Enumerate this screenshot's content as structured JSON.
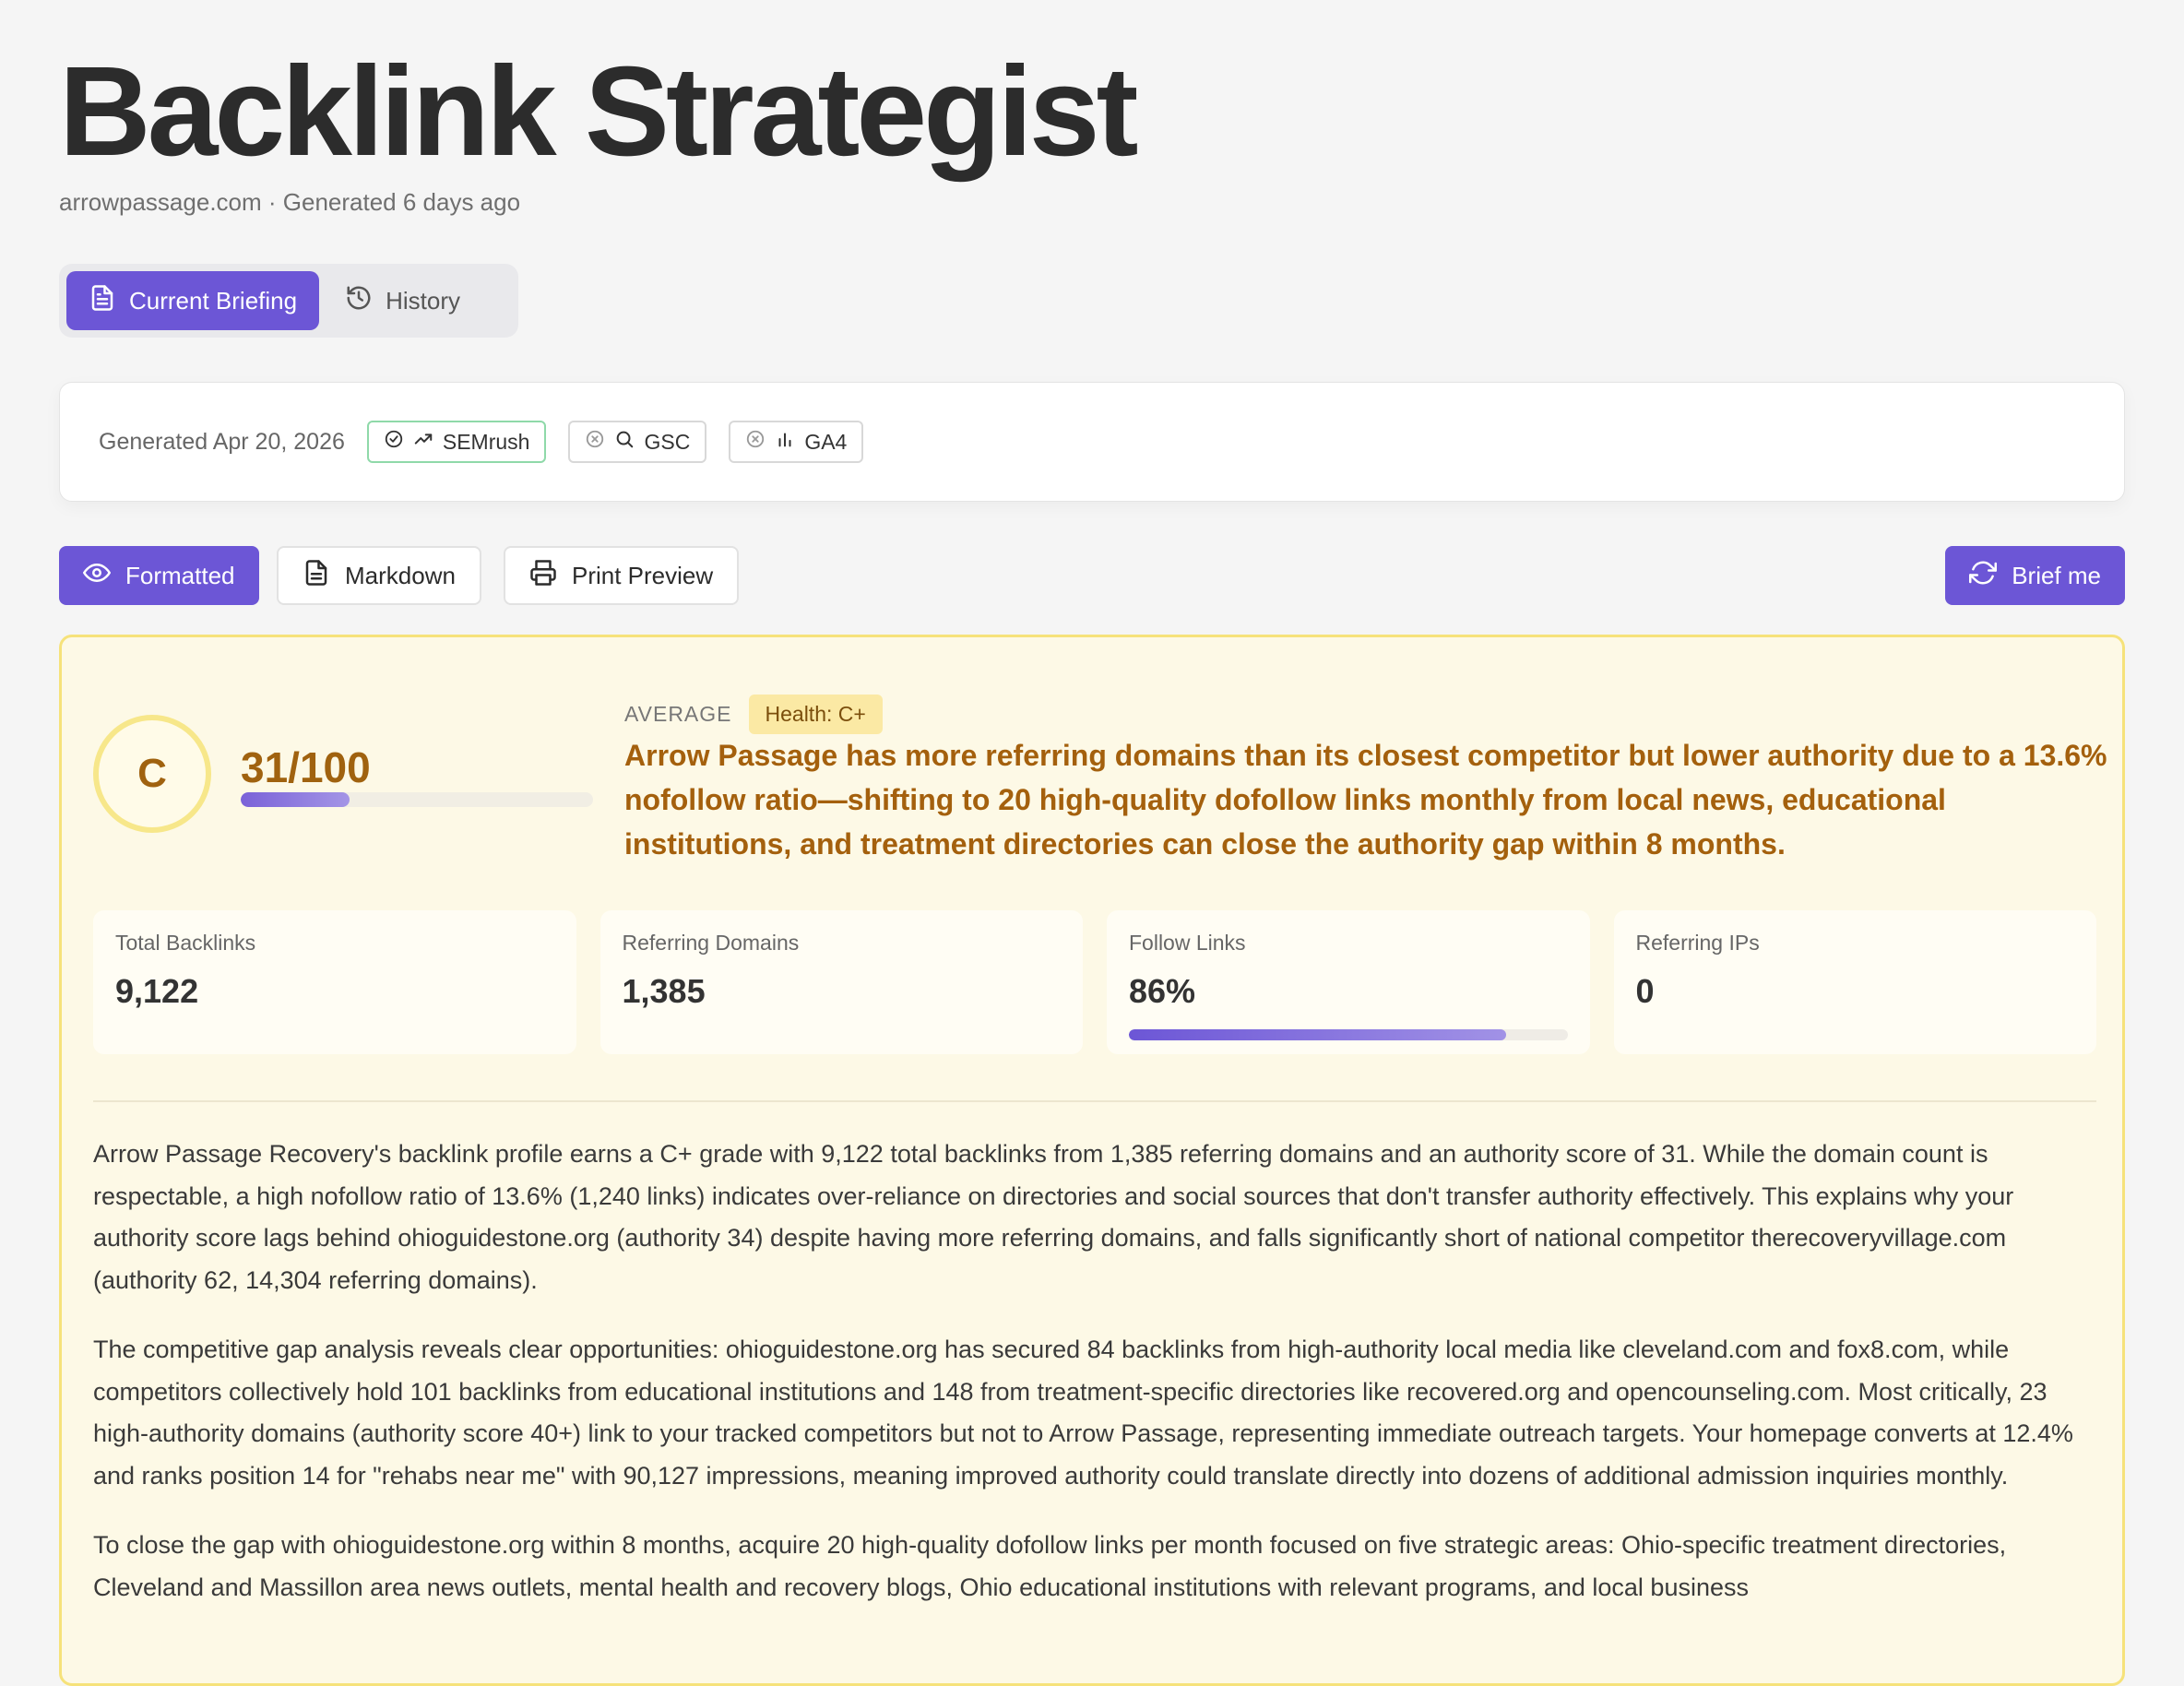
{
  "header": {
    "title": "Backlink Strategist",
    "subtitle": "arrowpassage.com · Generated 6 days ago"
  },
  "tabs": [
    {
      "label": "Current Briefing",
      "icon": "document-icon",
      "active": true
    },
    {
      "label": "History",
      "icon": "history-icon",
      "active": false
    }
  ],
  "meta": {
    "generated": "Generated Apr 20, 2026",
    "sources": [
      {
        "label": "SEMrush",
        "status": "connected",
        "icon": "trending-up-icon"
      },
      {
        "label": "GSC",
        "status": "disconnected",
        "icon": "search-icon"
      },
      {
        "label": "GA4",
        "status": "disconnected",
        "icon": "bar-chart-icon"
      }
    ]
  },
  "toolbar": {
    "formatted": "Formatted",
    "markdown": "Markdown",
    "print_preview": "Print Preview",
    "brief_me": "Brief me"
  },
  "report": {
    "grade": "C",
    "score": "31/100",
    "score_fraction": 0.31,
    "level": "AVERAGE",
    "health": "Health: C+",
    "headline": "Arrow Passage has more referring domains than its closest competitor but lower authority due to a 13.6% nofollow ratio—shifting to 20 high-quality dofollow links monthly from local news, educational institutions, and treatment directories can close the authority gap within 8 months.",
    "stats": [
      {
        "label": "Total Backlinks",
        "value": "9,122"
      },
      {
        "label": "Referring Domains",
        "value": "1,385"
      },
      {
        "label": "Follow Links",
        "value": "86%",
        "fraction": 0.86
      },
      {
        "label": "Referring IPs",
        "value": "0"
      }
    ],
    "paragraphs": [
      "Arrow Passage Recovery's backlink profile earns a C+ grade with 9,122 total backlinks from 1,385 referring domains and an authority score of 31. While the domain count is respectable, a high nofollow ratio of 13.6% (1,240 links) indicates over-reliance on directories and social sources that don't transfer authority effectively. This explains why your authority score lags behind ohioguidestone.org (authority 34) despite having more referring domains, and falls significantly short of national competitor therecoveryvillage.com (authority 62, 14,304 referring domains).",
      "The competitive gap analysis reveals clear opportunities: ohioguidestone.org has secured 84 backlinks from high-authority local media like cleveland.com and fox8.com, while competitors collectively hold 101 backlinks from educational institutions and 148 from treatment-specific directories like recovered.org and opencounseling.com. Most critically, 23 high-authority domains (authority score 40+) link to your tracked competitors but not to Arrow Passage, representing immediate outreach targets. Your homepage converts at 12.4% and ranks position 14 for \"rehabs near me\" with 90,127 impressions, meaning improved authority could translate directly into dozens of additional admission inquiries monthly.",
      "To close the gap with ohioguidestone.org within 8 months, acquire 20 high-quality dofollow links per month focused on five strategic areas: Ohio-specific treatment directories, Cleveland and Massillon area news outlets, mental health and recovery blogs, Ohio educational institutions with relevant programs, and local business"
    ]
  },
  "colors": {
    "accent": "#6c56d6",
    "report_bg": "#fdf9e6",
    "report_border": "#f6e27a",
    "headline": "#a4600d"
  }
}
